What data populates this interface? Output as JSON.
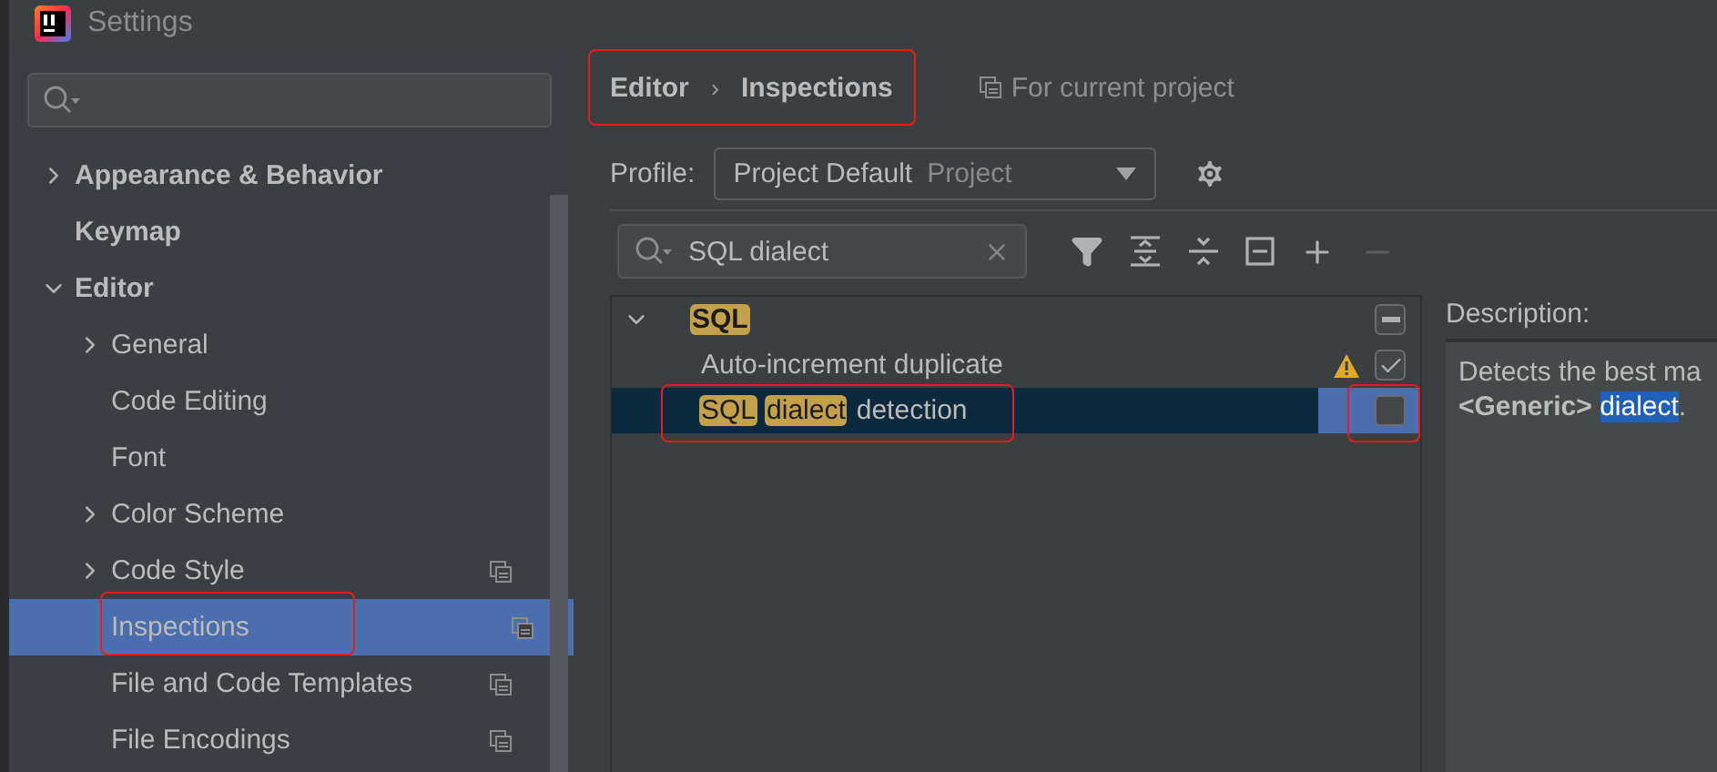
{
  "window": {
    "title": "Settings"
  },
  "sidebar": {
    "items": [
      {
        "label": "Appearance & Behavior",
        "expandable": true,
        "expanded": false,
        "selected": false,
        "project_scope": false,
        "annotated": false
      },
      {
        "label": "Keymap",
        "expandable": false,
        "expanded": false,
        "selected": false,
        "project_scope": false,
        "annotated": false
      },
      {
        "label": "Editor",
        "expandable": true,
        "expanded": true,
        "selected": false,
        "project_scope": false,
        "annotated": false,
        "children": [
          {
            "label": "General",
            "expandable": true,
            "expanded": false,
            "selected": false,
            "project_scope": false,
            "annotated": false
          },
          {
            "label": "Code Editing",
            "expandable": false,
            "expanded": false,
            "selected": false,
            "project_scope": false,
            "annotated": false
          },
          {
            "label": "Font",
            "expandable": false,
            "expanded": false,
            "selected": false,
            "project_scope": false,
            "annotated": false
          },
          {
            "label": "Color Scheme",
            "expandable": true,
            "expanded": false,
            "selected": false,
            "project_scope": false,
            "annotated": false
          },
          {
            "label": "Code Style",
            "expandable": true,
            "expanded": false,
            "selected": false,
            "project_scope": true,
            "annotated": false
          },
          {
            "label": "Inspections",
            "expandable": false,
            "expanded": false,
            "selected": true,
            "project_scope": true,
            "annotated": true
          },
          {
            "label": "File and Code Templates",
            "expandable": false,
            "expanded": false,
            "selected": false,
            "project_scope": true,
            "annotated": false
          },
          {
            "label": "File Encodings",
            "expandable": false,
            "expanded": false,
            "selected": false,
            "project_scope": true,
            "annotated": false
          }
        ]
      }
    ]
  },
  "breadcrumb": {
    "items": [
      "Editor",
      "Inspections"
    ],
    "separator": "›",
    "annotated": true,
    "scope_note": "For current project"
  },
  "profile": {
    "label": "Profile:",
    "value": "Project Default",
    "hint": "Project"
  },
  "filter": {
    "value": "SQL dialect"
  },
  "tree": {
    "groups": [
      {
        "segments": [
          {
            "text": "SQL",
            "match": true
          }
        ],
        "expanded": true,
        "mixed": true,
        "rows": [
          {
            "segments": [
              {
                "text": "Auto-increment duplicate",
                "match": false
              }
            ],
            "warning": true,
            "checked": true,
            "selected": false,
            "annotated": false
          },
          {
            "segments": [
              {
                "text": "SQL",
                "match": true
              },
              {
                "text": "dialect",
                "match": true
              },
              {
                "text": "detection",
                "match": false
              }
            ],
            "warning": false,
            "checked": false,
            "selected": true,
            "annotated": true
          }
        ]
      }
    ]
  },
  "description": {
    "label": "Description:",
    "lines": [
      [
        {
          "text": "Detects the best ma",
          "bold": false,
          "selected": false
        }
      ],
      [
        {
          "text": "<Generic> ",
          "bold": true,
          "selected": false
        },
        {
          "text": "dialect",
          "bold": false,
          "selected": true
        },
        {
          "text": ".",
          "bold": false,
          "selected": false
        }
      ]
    ]
  }
}
